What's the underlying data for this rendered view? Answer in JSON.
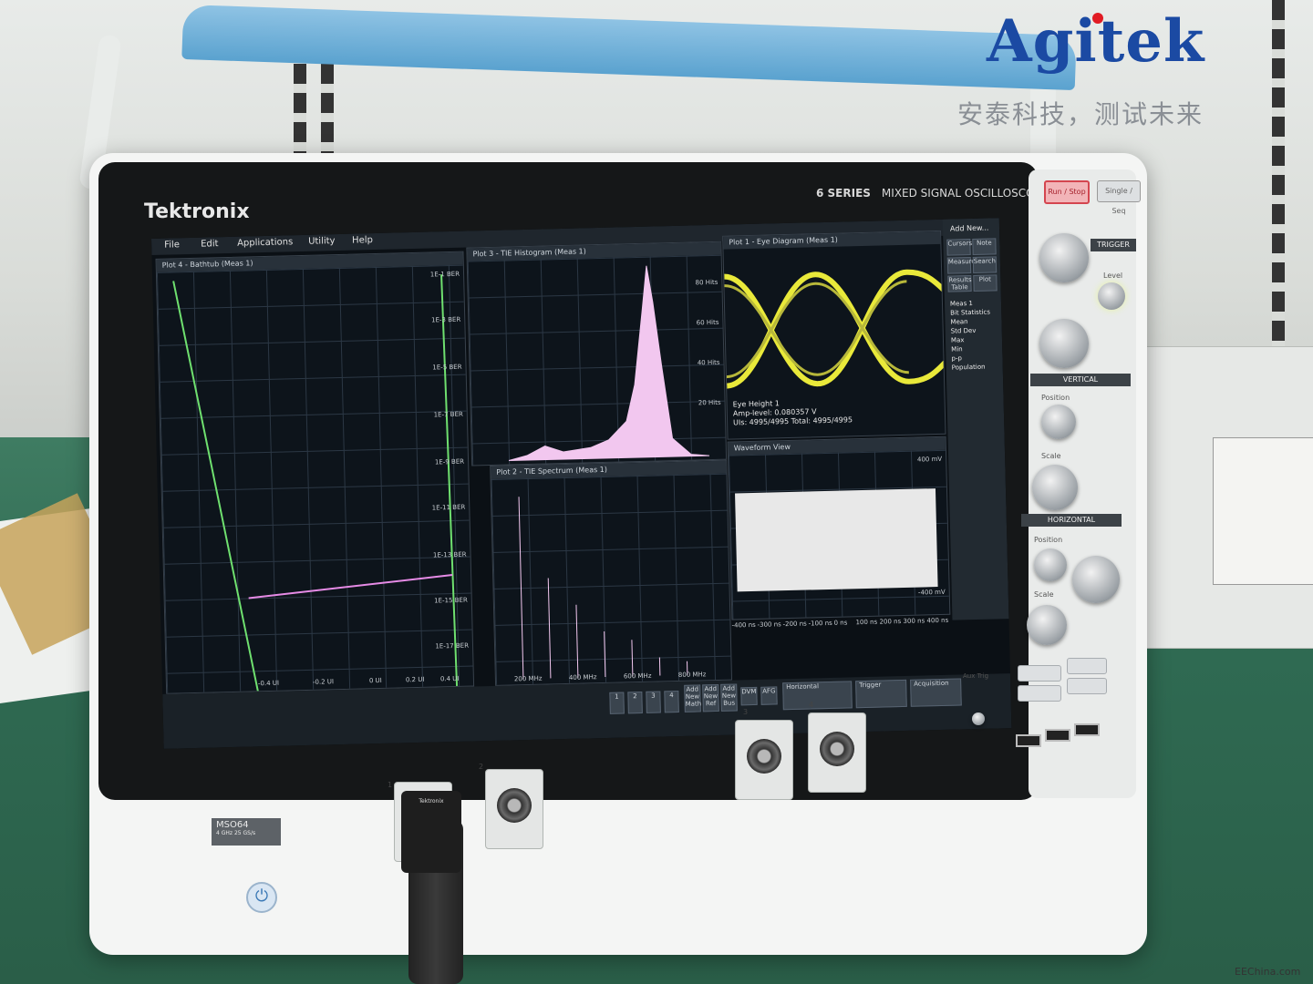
{
  "watermark": {
    "logo": "Agitek",
    "slogan": "安泰科技，测试未来",
    "source": "EEChina.com"
  },
  "instrument": {
    "brand": "Tektronix",
    "series": "6 SERIES",
    "type": "MIXED SIGNAL OSCILLOSCOPE",
    "model": "MSO64",
    "model_sub_a": "4 GHz",
    "model_sub_b": "25 GS/s",
    "aux_trig": "Aux Trig"
  },
  "menu": [
    "File",
    "Edit",
    "Applications",
    "Utility",
    "Help"
  ],
  "plots": {
    "bathtub": {
      "title": "Plot 4 - Bathtub (Meas 1)",
      "y_labels": [
        "1E-1 BER",
        "1E-3 BER",
        "1E-5 BER",
        "1E-7 BER",
        "1E-9 BER",
        "1E-11 BER",
        "1E-13 BER",
        "1E-15 BER",
        "1E-17 BER"
      ],
      "x_labels": [
        "-0.4 UI",
        "-0.2 UI",
        "0 UI",
        "0.2 UI",
        "0.4 UI"
      ]
    },
    "histogram": {
      "title": "Plot 3 - TIE Histogram (Meas 1)",
      "y_labels": [
        "80 Hits",
        "60 Hits",
        "40 Hits",
        "20 Hits"
      ]
    },
    "eye": {
      "title": "Plot 1 - Eye Diagram (Meas 1)",
      "readout": [
        "Eye Height 1",
        "Amp-level: 0.080357 V",
        "UIs: 4995/4995  Total: 4995/4995"
      ]
    },
    "spectrum": {
      "title": "Plot 2 - TIE Spectrum (Meas 1)",
      "x_labels": [
        "200 MHz",
        "400 MHz",
        "600 MHz",
        "800 MHz"
      ]
    },
    "waveform": {
      "title": "Waveform View",
      "x_labels": [
        "-400 ns",
        "-300 ns",
        "-200 ns",
        "-100 ns",
        "0 ns",
        "100 ns",
        "200 ns",
        "300 ns",
        "400 ns"
      ],
      "y_labels": [
        "400 mV",
        "-400 mV"
      ]
    }
  },
  "side_menu": {
    "title": "Add New...",
    "buttons": [
      "Cursors",
      "Note",
      "Measure",
      "Search",
      "Results Table",
      "Plot"
    ],
    "meas_title": "Meas 1",
    "meas_rows": [
      "Bit Statistics",
      "Mean",
      "Std Dev",
      "Max",
      "Min",
      "p-p",
      "Population"
    ]
  },
  "bottom_bar": {
    "channels": [
      "1",
      "2",
      "3",
      "4"
    ],
    "add_buttons": [
      "Add New Math",
      "Add New Ref",
      "Add New Bus"
    ],
    "dvm": "DVM",
    "afg": "AFG",
    "horizontal": "Horizontal",
    "trigger": "Trigger",
    "acquisition": "Acquisition"
  },
  "controls": {
    "run_stop": "Run / Stop",
    "single_seq": "Single / Seq",
    "trigger": "TRIGGER",
    "level": "Level",
    "vertical": "VERTICAL",
    "position": "Position",
    "scale": "Scale",
    "horizontal": "HORIZONTAL"
  },
  "probe_label": "Tektronix"
}
